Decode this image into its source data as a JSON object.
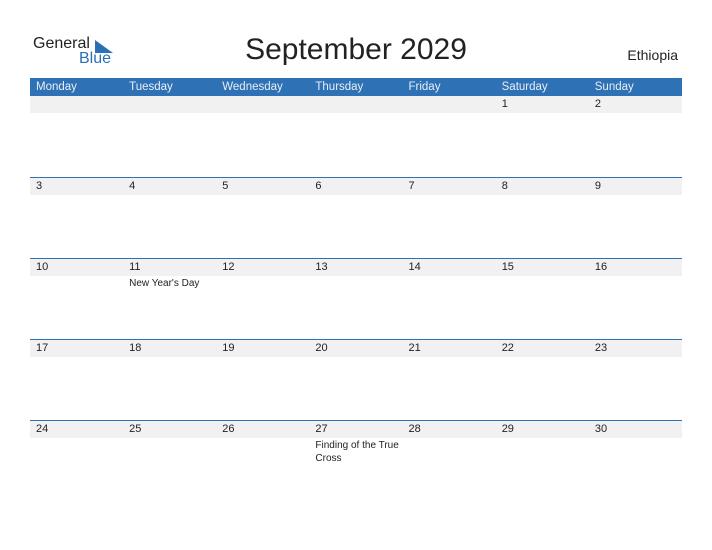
{
  "logo": {
    "line1": "General",
    "line2": "Blue",
    "accent": "#2b70b4"
  },
  "title": "September 2029",
  "country": "Ethiopia",
  "header_color": "#2e72b5",
  "weekdays": [
    "Monday",
    "Tuesday",
    "Wednesday",
    "Thursday",
    "Friday",
    "Saturday",
    "Sunday"
  ],
  "weeks": [
    [
      {
        "day": ""
      },
      {
        "day": ""
      },
      {
        "day": ""
      },
      {
        "day": ""
      },
      {
        "day": ""
      },
      {
        "day": "1"
      },
      {
        "day": "2"
      }
    ],
    [
      {
        "day": "3"
      },
      {
        "day": "4"
      },
      {
        "day": "5"
      },
      {
        "day": "6"
      },
      {
        "day": "7"
      },
      {
        "day": "8"
      },
      {
        "day": "9"
      }
    ],
    [
      {
        "day": "10"
      },
      {
        "day": "11",
        "event": "New Year's Day"
      },
      {
        "day": "12"
      },
      {
        "day": "13"
      },
      {
        "day": "14"
      },
      {
        "day": "15"
      },
      {
        "day": "16"
      }
    ],
    [
      {
        "day": "17"
      },
      {
        "day": "18"
      },
      {
        "day": "19"
      },
      {
        "day": "20"
      },
      {
        "day": "21"
      },
      {
        "day": "22"
      },
      {
        "day": "23"
      }
    ],
    [
      {
        "day": "24"
      },
      {
        "day": "25"
      },
      {
        "day": "26"
      },
      {
        "day": "27",
        "event": "Finding of the True Cross"
      },
      {
        "day": "28"
      },
      {
        "day": "29"
      },
      {
        "day": "30"
      }
    ]
  ]
}
